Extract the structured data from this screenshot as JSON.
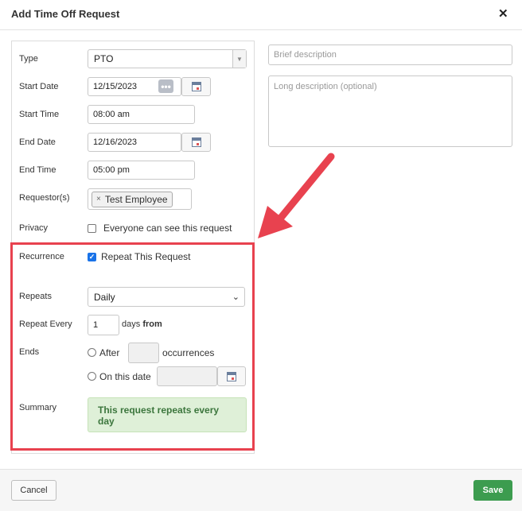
{
  "dialog": {
    "title": "Add Time Off Request",
    "close_icon": "close-icon",
    "close_glyph": "✕"
  },
  "form": {
    "type": {
      "label": "Type",
      "value": "PTO"
    },
    "start_date": {
      "label": "Start Date",
      "value": "12/15/2023"
    },
    "start_time": {
      "label": "Start Time",
      "value": "08:00 am"
    },
    "end_date": {
      "label": "End Date",
      "value": "12/16/2023"
    },
    "end_time": {
      "label": "End Time",
      "value": "05:00 pm"
    },
    "requestors": {
      "label": "Requestor(s)",
      "chip_remove": "×",
      "chip": "Test Employee"
    },
    "privacy": {
      "label": "Privacy",
      "checkbox_label": "Everyone can see this request",
      "checked": false
    },
    "recurrence": {
      "label": "Recurrence",
      "checkbox_label": "Repeat This Request",
      "checked": true
    },
    "repeats": {
      "label": "Repeats",
      "value": "Daily"
    },
    "repeat_every": {
      "label": "Repeat Every",
      "value": "1",
      "unit": "days",
      "suffix": "from"
    },
    "ends": {
      "label": "Ends",
      "after_label": "After",
      "occurrences_label": "occurrences",
      "on_date_label": "On this date"
    },
    "summary": {
      "label": "Summary",
      "text": "This request repeats every day"
    }
  },
  "right": {
    "brief_placeholder": "Brief description",
    "long_placeholder": "Long description (optional)"
  },
  "footer": {
    "cancel_label": "Cancel",
    "save_label": "Save"
  },
  "colors": {
    "highlight_border": "#e8424f",
    "save_button": "#3c9c4f",
    "summary_bg": "#dff0d8",
    "summary_text": "#3c763d"
  }
}
